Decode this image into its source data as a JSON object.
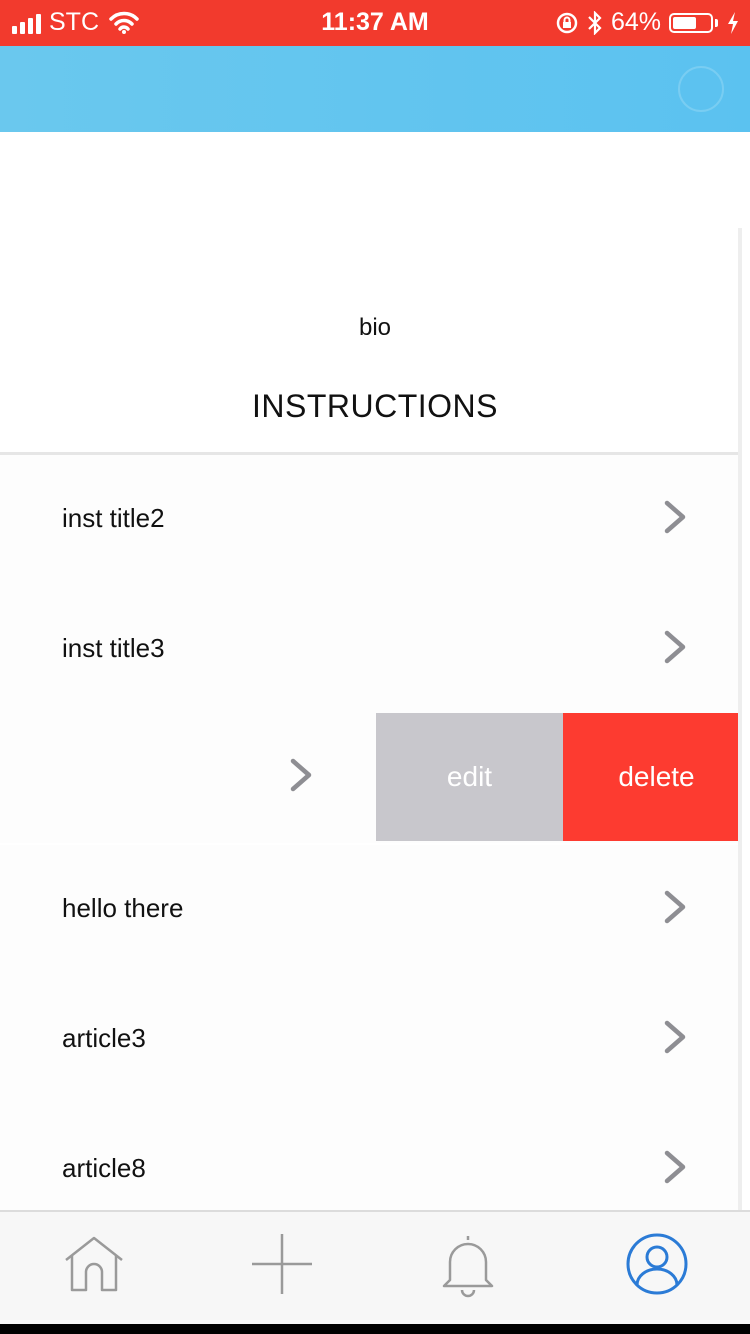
{
  "status_bar": {
    "carrier": "STC",
    "time": "11:37 AM",
    "battery_percent": "64%",
    "battery_level": 0.64,
    "icons": [
      "signal-icon",
      "wifi-icon",
      "rotation-lock-icon",
      "bluetooth-icon",
      "battery-icon",
      "charging-icon"
    ]
  },
  "colors": {
    "status_bar": "#f23a2d",
    "nav_bar": "#5bc2f0",
    "edit": "#c8c7cc",
    "delete": "#fd3b30",
    "tab_active": "#2b7bd6"
  },
  "profile": {
    "bio": "bio",
    "section_title": "INSTRUCTIONS"
  },
  "list": {
    "items": [
      {
        "label": "inst title2"
      },
      {
        "label": "inst title3"
      },
      {
        "label": ""
      },
      {
        "label": "hello there"
      },
      {
        "label": "article3"
      },
      {
        "label": "article8"
      }
    ],
    "swipe_actions": {
      "edit_label": "edit",
      "delete_label": "delete"
    }
  },
  "tab_bar": {
    "tabs": [
      {
        "icon": "home-icon",
        "active": false
      },
      {
        "icon": "add-icon",
        "active": false
      },
      {
        "icon": "bell-icon",
        "active": false
      },
      {
        "icon": "profile-icon",
        "active": true
      }
    ]
  }
}
